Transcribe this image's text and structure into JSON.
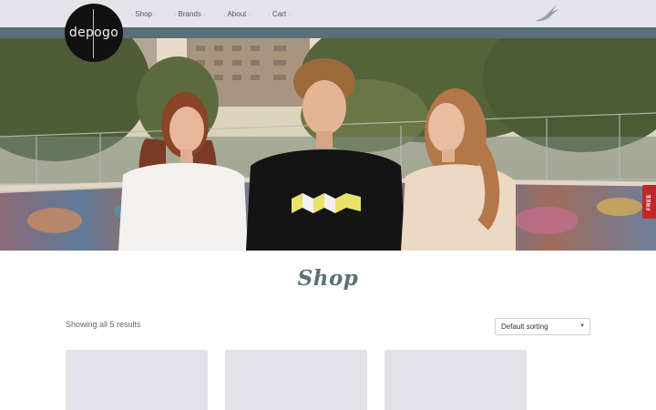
{
  "brand": {
    "logo_text": "depogo"
  },
  "nav": {
    "items": [
      {
        "label": "Shop"
      },
      {
        "label": "Brands"
      },
      {
        "label": "About"
      },
      {
        "label": "Cart"
      }
    ]
  },
  "icons": {
    "bird": "swallow-icon",
    "chevron": "chevron-down-icon"
  },
  "colors": {
    "topbar": "#e4e4ea",
    "strip": "#5a7078",
    "accent": "#5d7077",
    "side_tab": "#c0272d"
  },
  "side_tab": {
    "label": "FREE"
  },
  "page": {
    "title": "Shop",
    "result_count": "Showing all 5 results"
  },
  "sort": {
    "selected": "Default sorting"
  },
  "products": {
    "visible_count": 3
  }
}
